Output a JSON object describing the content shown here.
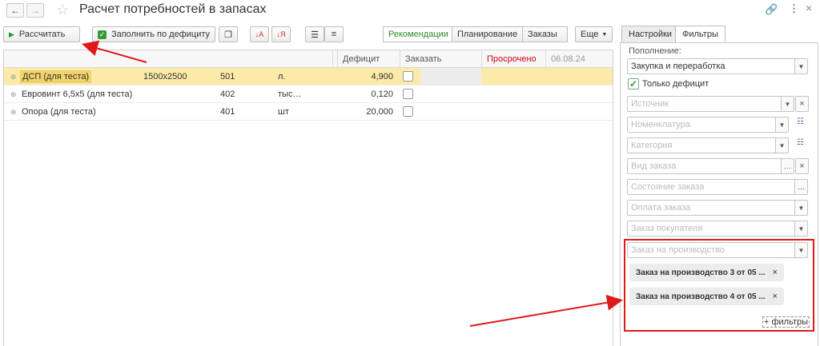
{
  "window": {
    "title": "Расчет потребностей в запасах",
    "back_icon": "arrow-left-icon",
    "forward_icon": "arrow-right-icon",
    "favorite_icon": "star-icon",
    "link_icon": "link-icon",
    "more_icon": "kebab-icon",
    "close_icon": "close-icon"
  },
  "toolbar": {
    "calculate_label": "Рассчитать",
    "fill_label": "Заполнить по дефициту",
    "segments": [
      "Рекомендации",
      "Планирование",
      "Заказы"
    ],
    "more_label": "Еще"
  },
  "table": {
    "headers": {
      "deficit": "Дефицит",
      "order": "Заказать",
      "overdue": "Просрочено",
      "date": "06.08.24"
    },
    "rows": [
      {
        "name": "ДСП (для теста)",
        "spec": "1500x2500",
        "code": "501",
        "unit": "л.",
        "deficit": "4,900"
      },
      {
        "name": "Евровинт 6,5x5 (для теста)",
        "spec": "",
        "code": "402",
        "unit": "тыс…",
        "deficit": "0,120"
      },
      {
        "name": "Опора (для теста)",
        "spec": "",
        "code": "401",
        "unit": "шт",
        "deficit": "20,000"
      }
    ]
  },
  "panel": {
    "tabs": [
      "Настройки",
      "Фильтры"
    ],
    "replenishment_label": "Пополнение:",
    "replenishment_value": "Закупка и переработка",
    "only_deficit_label": "Только дефицит",
    "placeholders": {
      "source": "Источник",
      "nomenclature": "Номенклатура",
      "category": "Категория",
      "order_type": "Вид заказа",
      "order_state": "Состояние заказа",
      "order_payment": "Оплата заказа",
      "customer_order": "Заказ покупателя",
      "production_order": "Заказ на производство"
    },
    "chips": [
      "Заказ на производство 3 от 05 ...",
      "Заказ на производство 4 от 05 ..."
    ],
    "add_filters_label": "+ фильтры"
  },
  "colors": {
    "annotation_red": "#e0191b",
    "selected_row": "#fbeaa8",
    "accent_green": "#2a8c2a",
    "overdue_red": "#d0021b"
  }
}
